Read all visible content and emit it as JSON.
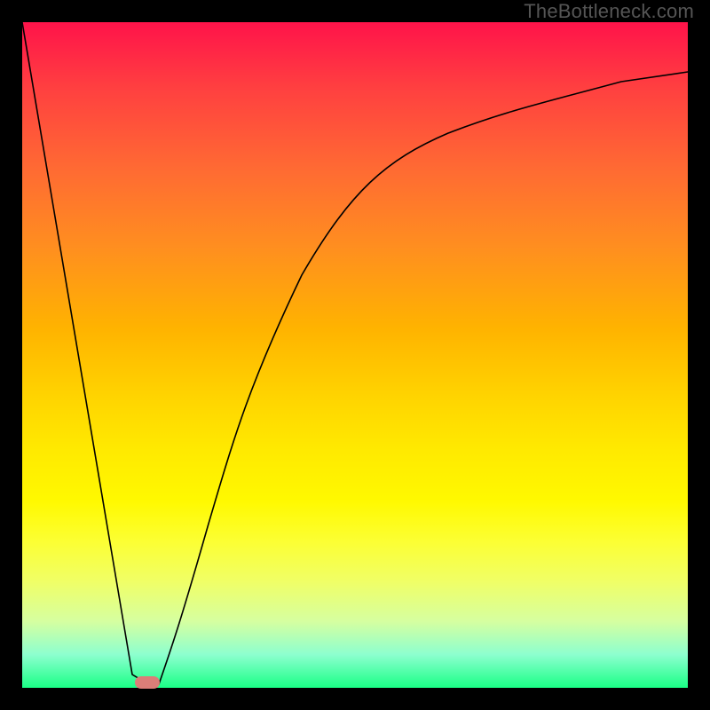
{
  "watermark": "TheBottleneck.com",
  "chart_data": {
    "type": "line",
    "title": "",
    "xlabel": "",
    "ylabel": "",
    "xlim": [
      0,
      100
    ],
    "ylim": [
      0,
      100
    ],
    "grid": false,
    "legend": false,
    "series": [
      {
        "name": "left-line",
        "x": [
          0,
          16.5,
          19
        ],
        "values": [
          100,
          2,
          0.5
        ]
      },
      {
        "name": "right-curve",
        "x": [
          20.5,
          24,
          28,
          34,
          42,
          52,
          64,
          78,
          90,
          100
        ],
        "values": [
          0.5,
          10,
          25,
          45,
          62,
          74,
          82,
          88,
          91,
          92.5
        ]
      }
    ],
    "marker": {
      "x": 19,
      "y": 0.2,
      "color": "#db7e78"
    }
  },
  "colors": {
    "frame": "#000000",
    "watermark": "#555555",
    "marker": "#db7e78"
  }
}
